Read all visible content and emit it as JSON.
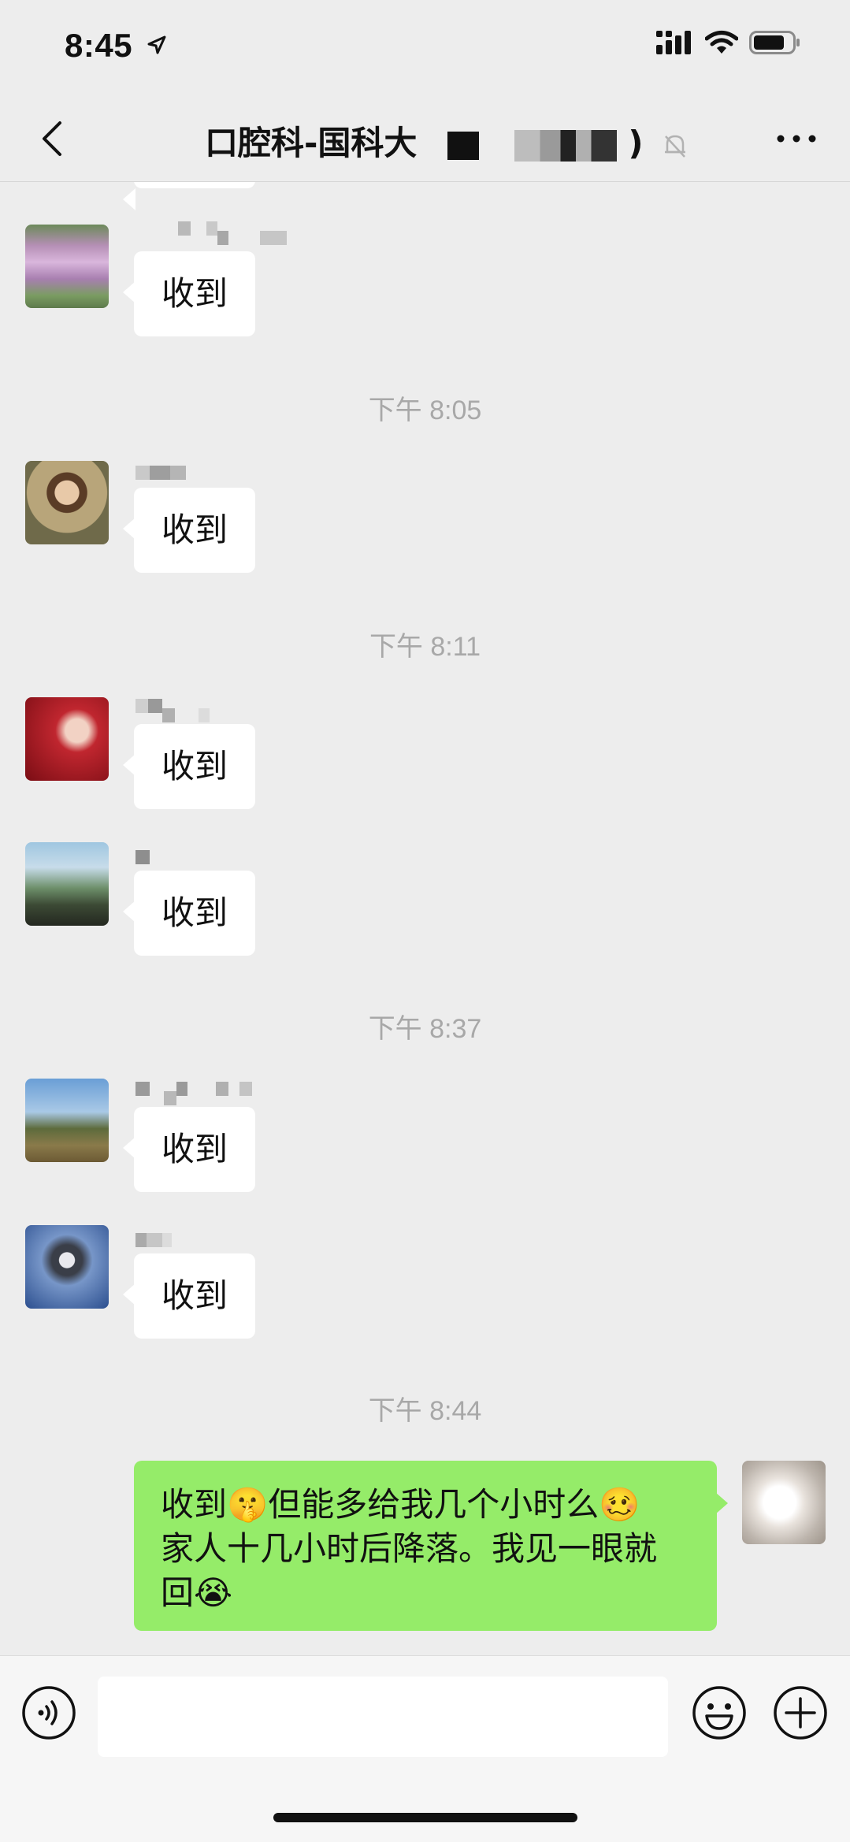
{
  "status_bar": {
    "time": "8:45"
  },
  "nav": {
    "title": "口腔科-国科大",
    "title_suffix": ")"
  },
  "messages": [
    {
      "type": "text",
      "side": "left",
      "text": "收到",
      "avatar": "flowers-avatar"
    },
    {
      "type": "time",
      "text": "下午 8:05"
    },
    {
      "type": "text",
      "side": "left",
      "text": "收到",
      "avatar": "painting-avatar"
    },
    {
      "type": "time",
      "text": "下午 8:11"
    },
    {
      "type": "text",
      "side": "left",
      "text": "收到",
      "avatar": "hand-avatar"
    },
    {
      "type": "text",
      "side": "left",
      "text": "收到",
      "avatar": "landscape-avatar"
    },
    {
      "type": "time",
      "text": "下午 8:37"
    },
    {
      "type": "text",
      "side": "left",
      "text": "收到",
      "avatar": "trees-avatar"
    },
    {
      "type": "text",
      "side": "left",
      "text": "收到",
      "avatar": "husky-avatar"
    },
    {
      "type": "time",
      "text": "下午 8:44"
    },
    {
      "type": "text",
      "side": "right",
      "avatar": "dog-avatar",
      "lines": [
        "收到🤫但能多给我几个小时么🥴",
        "家人十几小时后降落。我见一眼就",
        "回😭"
      ]
    }
  ],
  "colors": {
    "background": "#ededed",
    "bubble_in": "#ffffff",
    "bubble_out": "#95ec69",
    "timestamp": "#a8a8a8"
  },
  "icons": [
    "back-icon",
    "location-arrow-icon",
    "signal-icon",
    "wifi-icon",
    "battery-icon",
    "mute-bell-icon",
    "more-icon",
    "voice-icon",
    "emoji-icon",
    "plus-icon"
  ]
}
